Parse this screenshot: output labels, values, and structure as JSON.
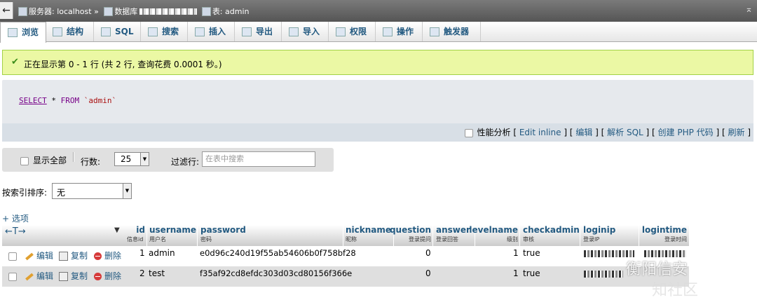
{
  "topbar": {
    "back": "←",
    "server_label": "服务器: localhost »",
    "db_label": "数据库",
    "table_label": "表: admin",
    "collapse": "⌅"
  },
  "tabs": [
    {
      "label": "浏览",
      "icon": "browse-icon"
    },
    {
      "label": "结构",
      "icon": "structure-icon"
    },
    {
      "label": "SQL",
      "icon": "sql-icon"
    },
    {
      "label": "搜索",
      "icon": "search-icon"
    },
    {
      "label": "插入",
      "icon": "insert-icon"
    },
    {
      "label": "导出",
      "icon": "export-icon"
    },
    {
      "label": "导入",
      "icon": "import-icon"
    },
    {
      "label": "权限",
      "icon": "privileges-icon"
    },
    {
      "label": "操作",
      "icon": "operations-icon"
    },
    {
      "label": "触发器",
      "icon": "triggers-icon"
    }
  ],
  "message": "正在显示第 0 - 1 行 (共 2 行, 查询花费 0.0001 秒。)",
  "sql": {
    "select": "SELECT",
    "star": " * ",
    "from": "FROM",
    "table": " `admin`"
  },
  "sql_actions": {
    "profiling": "性能分析",
    "edit_inline": "Edit inline",
    "edit": "编辑",
    "explain": "解析 SQL",
    "create_php": "创建 PHP 代码",
    "refresh": "刷新"
  },
  "nav": {
    "show_all": "显示全部",
    "rows_label": "行数:",
    "rows_value": "25",
    "filter_label": "过滤行:",
    "filter_placeholder": "在表中搜索"
  },
  "sort": {
    "label": "按索引排序:",
    "value": "无"
  },
  "options_link": "+ 选项",
  "columns": [
    {
      "name": "id",
      "comment": "信息id"
    },
    {
      "name": "username",
      "comment": "用户名"
    },
    {
      "name": "password",
      "comment": "密码"
    },
    {
      "name": "nickname",
      "comment": "昵称"
    },
    {
      "name": "question",
      "comment": "登录提问"
    },
    {
      "name": "answer",
      "comment": "登录回答"
    },
    {
      "name": "levelname",
      "comment": "级别"
    },
    {
      "name": "checkadmin",
      "comment": "审核"
    },
    {
      "name": "loginip",
      "comment": "登录IP"
    },
    {
      "name": "logintime",
      "comment": "登录时间"
    }
  ],
  "row_actions": {
    "edit": "编辑",
    "copy": "复制",
    "delete": "删除"
  },
  "rows": [
    {
      "id": "1",
      "username": "admin",
      "password": "e0d96c240d19f55ab54606b0f758bf28",
      "question": "0",
      "levelname": "1",
      "checkadmin": "true"
    },
    {
      "id": "2",
      "username": "test",
      "password": "f35af92cd8efdc303d03cd80156f366e",
      "question": "0",
      "levelname": "1",
      "checkadmin": "true"
    }
  ],
  "watermark": "衡阳信安",
  "watermark2": "知社区"
}
